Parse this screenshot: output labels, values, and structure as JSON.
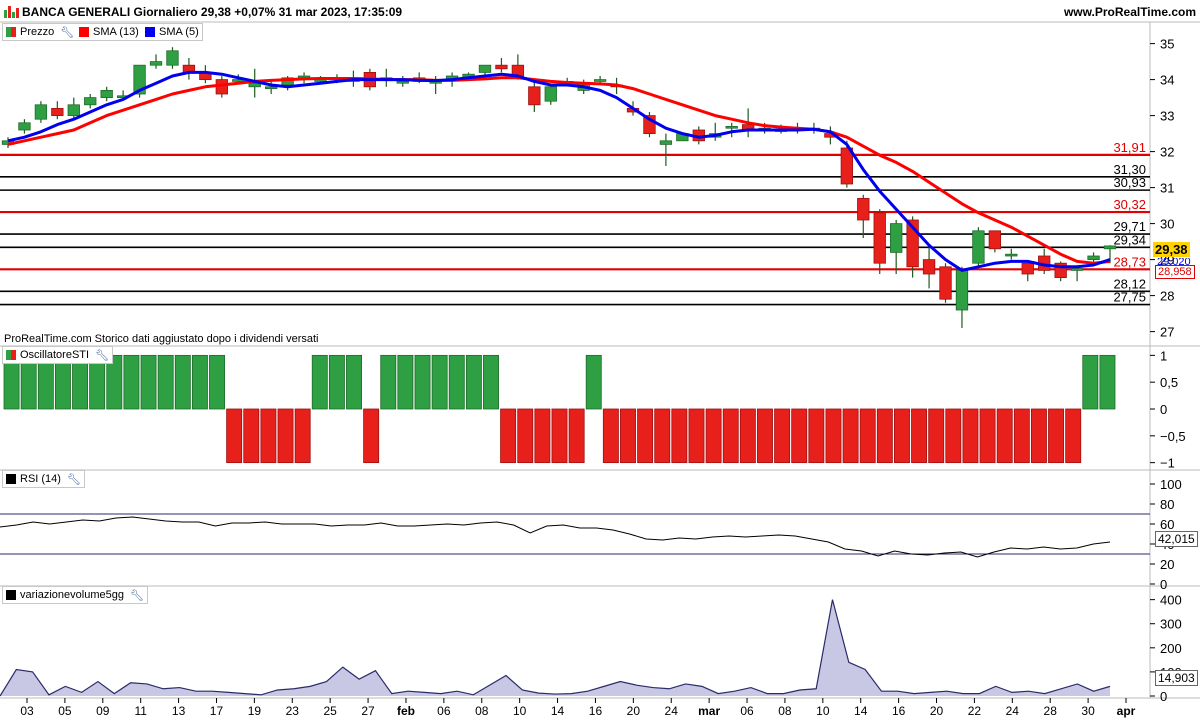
{
  "header": {
    "title": "BANCA GENERALI Giornaliero 29,38 +0,07% 31 mar 2023, 17:35:09",
    "site": "www.ProRealTime.com"
  },
  "colors": {
    "up": "#2ea043",
    "down": "#e8201c",
    "sma13": "#ff0000",
    "sma5": "#0000ee",
    "level_red": "#e00000",
    "level_black": "#000000",
    "volume_fill": "#c8c8e4"
  },
  "legend": {
    "price": {
      "label": "Prezzo",
      "icon": "wrench-icon"
    },
    "sma13": {
      "label": "SMA (13)"
    },
    "sma5": {
      "label": "SMA (5)"
    },
    "sti": {
      "label": "OscillatoreSTI"
    },
    "rsi": {
      "label": "RSI (14)"
    },
    "vol": {
      "label": "variazionevolume5gg"
    }
  },
  "note": "ProRealTime.com Storico dati aggiustato dopo i dividendi versati",
  "tags": {
    "last_price": "29,38",
    "sma13_value": "28,958",
    "sma5_value": "29,020",
    "rsi_value": "42,015",
    "vol_value": "14,903"
  },
  "chart_data": [
    {
      "type": "candlestick",
      "title": "BANCA GENERALI Giornaliero",
      "ylim": [
        26.6,
        35.6
      ],
      "yticks": [
        "27",
        "28",
        "29",
        "30",
        "31",
        "32",
        "33",
        "34",
        "35"
      ],
      "xtick_labels": [
        "03",
        "05",
        "09",
        "11",
        "13",
        "17",
        "19",
        "23",
        "25",
        "27",
        "feb",
        "06",
        "08",
        "10",
        "14",
        "16",
        "20",
        "24",
        "mar",
        "06",
        "08",
        "10",
        "14",
        "16",
        "20",
        "22",
        "24",
        "28",
        "30",
        "apr"
      ],
      "levels": [
        {
          "value": 31.91,
          "label": "31,91",
          "color": "red"
        },
        {
          "value": 31.3,
          "label": "31,30",
          "color": "black"
        },
        {
          "value": 30.93,
          "label": "30,93",
          "color": "black"
        },
        {
          "value": 30.32,
          "label": "30,32",
          "color": "red"
        },
        {
          "value": 29.71,
          "label": "29,71",
          "color": "black"
        },
        {
          "value": 29.34,
          "label": "29,34",
          "color": "black"
        },
        {
          "value": 28.73,
          "label": "28,73",
          "color": "red"
        },
        {
          "value": 28.12,
          "label": "28,12",
          "color": "black"
        },
        {
          "value": 27.75,
          "label": "27,75",
          "color": "black"
        }
      ],
      "ohlc": [
        [
          32.2,
          32.4,
          32.1,
          32.3
        ],
        [
          32.6,
          32.9,
          32.5,
          32.8
        ],
        [
          32.9,
          33.4,
          32.8,
          33.3
        ],
        [
          33.2,
          33.4,
          32.9,
          33.0
        ],
        [
          33.0,
          33.5,
          32.9,
          33.3
        ],
        [
          33.3,
          33.6,
          33.2,
          33.5
        ],
        [
          33.5,
          33.8,
          33.4,
          33.7
        ],
        [
          33.5,
          33.7,
          33.5,
          33.55
        ],
        [
          33.6,
          34.4,
          33.5,
          34.4
        ],
        [
          34.4,
          34.7,
          34.3,
          34.5
        ],
        [
          34.4,
          34.9,
          34.3,
          34.8
        ],
        [
          34.4,
          34.6,
          34.0,
          34.2
        ],
        [
          34.2,
          34.4,
          33.9,
          34.0
        ],
        [
          34.0,
          34.1,
          33.5,
          33.6
        ],
        [
          33.95,
          34.15,
          33.9,
          34.0
        ],
        [
          33.8,
          34.3,
          33.5,
          33.9
        ],
        [
          33.75,
          34.0,
          33.6,
          33.8
        ],
        [
          33.85,
          34.1,
          33.7,
          34.05
        ],
        [
          34.05,
          34.2,
          33.9,
          34.1
        ],
        [
          33.95,
          34.1,
          33.9,
          34.0
        ],
        [
          34.0,
          34.15,
          33.9,
          34.05
        ],
        [
          33.95,
          34.25,
          33.8,
          34.05
        ],
        [
          34.2,
          34.3,
          33.7,
          33.8
        ],
        [
          34.0,
          34.3,
          33.8,
          34.05
        ],
        [
          33.9,
          34.1,
          33.8,
          33.95
        ],
        [
          33.95,
          34.2,
          33.9,
          34.05
        ],
        [
          33.9,
          34.1,
          33.6,
          33.95
        ],
        [
          34.0,
          34.2,
          33.8,
          34.1
        ],
        [
          34.05,
          34.2,
          34.0,
          34.15
        ],
        [
          34.2,
          34.4,
          34.1,
          34.4
        ],
        [
          34.4,
          34.6,
          34.2,
          34.3
        ],
        [
          34.4,
          34.7,
          34.0,
          34.1
        ],
        [
          33.8,
          34.0,
          33.1,
          33.3
        ],
        [
          33.4,
          33.8,
          33.3,
          33.8
        ],
        [
          33.95,
          34.05,
          33.9,
          33.95
        ],
        [
          33.7,
          34.0,
          33.6,
          33.9
        ],
        [
          33.95,
          34.1,
          33.9,
          34.0
        ],
        [
          33.85,
          34.05,
          33.6,
          33.8
        ],
        [
          33.2,
          33.4,
          33.0,
          33.1
        ],
        [
          33.0,
          33.1,
          32.4,
          32.5
        ],
        [
          32.2,
          32.5,
          31.6,
          32.3
        ],
        [
          32.3,
          32.5,
          32.3,
          32.5
        ],
        [
          32.6,
          32.7,
          32.2,
          32.3
        ],
        [
          32.4,
          32.8,
          32.3,
          32.5
        ],
        [
          32.65,
          32.8,
          32.4,
          32.7
        ],
        [
          32.75,
          33.2,
          32.4,
          32.6
        ],
        [
          32.6,
          32.8,
          32.5,
          32.65
        ],
        [
          32.6,
          32.75,
          32.5,
          32.6
        ],
        [
          32.6,
          32.8,
          32.5,
          32.65
        ],
        [
          32.6,
          32.8,
          32.5,
          32.65
        ],
        [
          32.5,
          32.7,
          32.2,
          32.4
        ],
        [
          32.1,
          32.3,
          31.0,
          31.1
        ],
        [
          30.7,
          30.8,
          29.6,
          30.1
        ],
        [
          30.3,
          30.4,
          28.6,
          28.9
        ],
        [
          29.2,
          30.1,
          28.6,
          30.0
        ],
        [
          30.1,
          30.2,
          28.5,
          28.8
        ],
        [
          29.0,
          29.4,
          28.2,
          28.6
        ],
        [
          28.8,
          28.9,
          27.8,
          27.9
        ],
        [
          27.6,
          28.8,
          27.1,
          28.7
        ],
        [
          28.9,
          29.9,
          28.8,
          29.8
        ],
        [
          29.8,
          29.8,
          29.2,
          29.3
        ],
        [
          29.1,
          29.3,
          29.0,
          29.15
        ],
        [
          28.9,
          28.9,
          28.4,
          28.6
        ],
        [
          29.1,
          29.3,
          28.6,
          28.7
        ],
        [
          28.9,
          28.95,
          28.4,
          28.5
        ],
        [
          28.7,
          28.8,
          28.4,
          28.75
        ],
        [
          29.0,
          29.2,
          28.9,
          29.1
        ],
        [
          29.3,
          29.4,
          28.9,
          29.38
        ]
      ],
      "sma13": [
        32.2,
        32.3,
        32.4,
        32.5,
        32.6,
        32.8,
        33.0,
        33.15,
        33.3,
        33.45,
        33.6,
        33.7,
        33.8,
        33.85,
        33.9,
        33.95,
        33.98,
        34.0,
        34.02,
        34.03,
        34.03,
        34.03,
        34.02,
        34.0,
        34.0,
        34.0,
        33.98,
        33.98,
        34.0,
        34.02,
        34.05,
        34.05,
        34.0,
        33.95,
        33.92,
        33.9,
        33.88,
        33.85,
        33.75,
        33.6,
        33.45,
        33.3,
        33.15,
        33.0,
        32.9,
        32.8,
        32.72,
        32.68,
        32.65,
        32.62,
        32.55,
        32.4,
        32.15,
        31.9,
        31.7,
        31.45,
        31.15,
        30.85,
        30.55,
        30.3,
        30.1,
        29.9,
        29.65,
        29.4,
        29.15,
        28.95,
        28.9,
        28.95
      ],
      "sma5": [
        32.3,
        32.4,
        32.55,
        32.75,
        32.9,
        33.1,
        33.3,
        33.45,
        33.7,
        33.9,
        34.1,
        34.2,
        34.2,
        34.15,
        34.05,
        33.95,
        33.85,
        33.8,
        33.85,
        33.9,
        33.95,
        34.0,
        34.0,
        34.0,
        34.0,
        33.98,
        33.97,
        34.0,
        34.05,
        34.1,
        34.15,
        34.1,
        33.95,
        33.85,
        33.85,
        33.8,
        33.7,
        33.5,
        33.2,
        32.9,
        32.65,
        32.5,
        32.4,
        32.45,
        32.55,
        32.6,
        32.6,
        32.6,
        32.6,
        32.62,
        32.55,
        32.2,
        31.5,
        30.9,
        30.4,
        29.9,
        29.4,
        29.0,
        28.7,
        28.8,
        28.9,
        28.95,
        28.95,
        28.85,
        28.8,
        28.8,
        28.85,
        29.0
      ]
    },
    {
      "type": "bar",
      "title": "OscillatoreSTI",
      "ylim": [
        -1.1,
        1.1
      ],
      "yticks": [
        "1",
        "0,5",
        "0",
        "−0,5",
        "−1"
      ],
      "values": [
        1,
        1,
        1,
        1,
        1,
        1,
        1,
        1,
        1,
        1,
        1,
        1,
        1,
        -1,
        -1,
        -1,
        -1,
        -1,
        1,
        1,
        1,
        -1,
        1,
        1,
        1,
        1,
        1,
        1,
        1,
        -1,
        -1,
        -1,
        -1,
        -1,
        1,
        -1,
        -1,
        -1,
        -1,
        -1,
        -1,
        -1,
        -1,
        -1,
        -1,
        -1,
        -1,
        -1,
        -1,
        -1,
        -1,
        -1,
        -1,
        -1,
        -1,
        -1,
        -1,
        -1,
        -1,
        -1,
        -1,
        -1,
        -1,
        1,
        1
      ]
    },
    {
      "type": "line",
      "title": "RSI (14)",
      "ylim": [
        0,
        110
      ],
      "yticks": [
        "100",
        "80",
        "60",
        "40",
        "20",
        "0"
      ],
      "bands": [
        30,
        70
      ],
      "values": [
        57,
        59,
        62,
        60,
        62,
        64,
        63,
        66,
        67,
        65,
        63,
        62,
        62,
        58,
        61,
        61,
        62,
        60,
        60,
        60,
        58,
        59,
        59,
        61,
        58,
        58,
        59,
        60,
        59,
        61,
        62,
        59,
        51,
        58,
        59,
        56,
        56,
        54,
        50,
        45,
        44,
        46,
        45,
        47,
        48,
        47,
        48,
        49,
        48,
        45,
        42,
        35,
        33,
        28,
        33,
        30,
        29,
        31,
        32,
        27,
        32,
        36,
        35,
        37,
        35,
        36,
        40,
        42
      ]
    },
    {
      "type": "area",
      "title": "variazionevolume5gg",
      "ylim": [
        0,
        440
      ],
      "yticks": [
        "400",
        "300",
        "200",
        "100",
        "0"
      ],
      "values": [
        0,
        110,
        100,
        5,
        40,
        15,
        60,
        10,
        55,
        50,
        30,
        35,
        20,
        20,
        15,
        10,
        5,
        25,
        30,
        40,
        60,
        120,
        70,
        105,
        10,
        20,
        15,
        10,
        20,
        5,
        45,
        85,
        25,
        12,
        8,
        10,
        20,
        40,
        60,
        45,
        35,
        30,
        50,
        40,
        10,
        20,
        35,
        10,
        10,
        25,
        30,
        400,
        140,
        110,
        20,
        20,
        10,
        15,
        20,
        10,
        10,
        40,
        15,
        20,
        10,
        30,
        50,
        20,
        40
      ]
    }
  ]
}
